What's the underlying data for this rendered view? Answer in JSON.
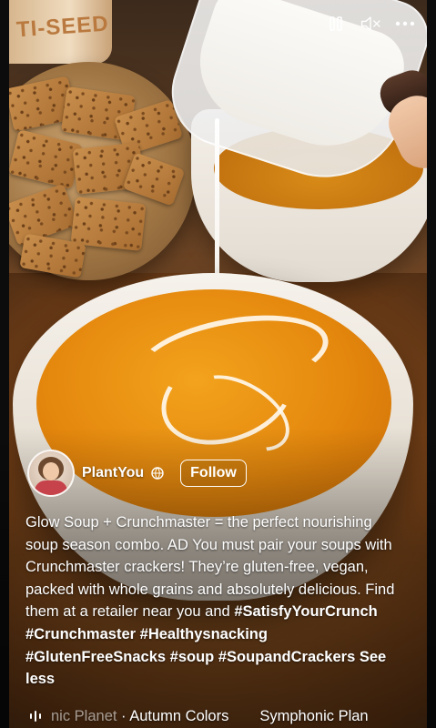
{
  "video": {
    "tin_text": "TI-SEED"
  },
  "controls": {
    "pause_icon": "pause-icon",
    "mute_icon": "muted-speaker-icon",
    "more_icon": "more-options-icon"
  },
  "author": {
    "name": "PlantYou",
    "follow_label": "Follow",
    "visibility_icon": "globe-icon"
  },
  "caption": {
    "text": "Glow Soup + Crunchmaster = the perfect nourishing soup season combo. AD You must pair your soups with Crunchmaster crackers! They’re gluten-free, vegan, packed with whole grains and absolutely delicious. Find them at a retailer near you and ",
    "hashtags": [
      "#SatisfyYourCrunch",
      "#Crunchmaster",
      "#Healthysnacking",
      "#GlutenFreeSnacks",
      "#soup",
      "#SoupandCrackers"
    ],
    "see_less_label": "See less"
  },
  "music": {
    "icon": "audio-bars-icon",
    "track_faded": "nic Planet",
    "track_current": " · Autumn Colors",
    "track_next": "Symphonic Plan"
  },
  "colors": {
    "soup": "#e4870d",
    "text": "#ffffff"
  }
}
